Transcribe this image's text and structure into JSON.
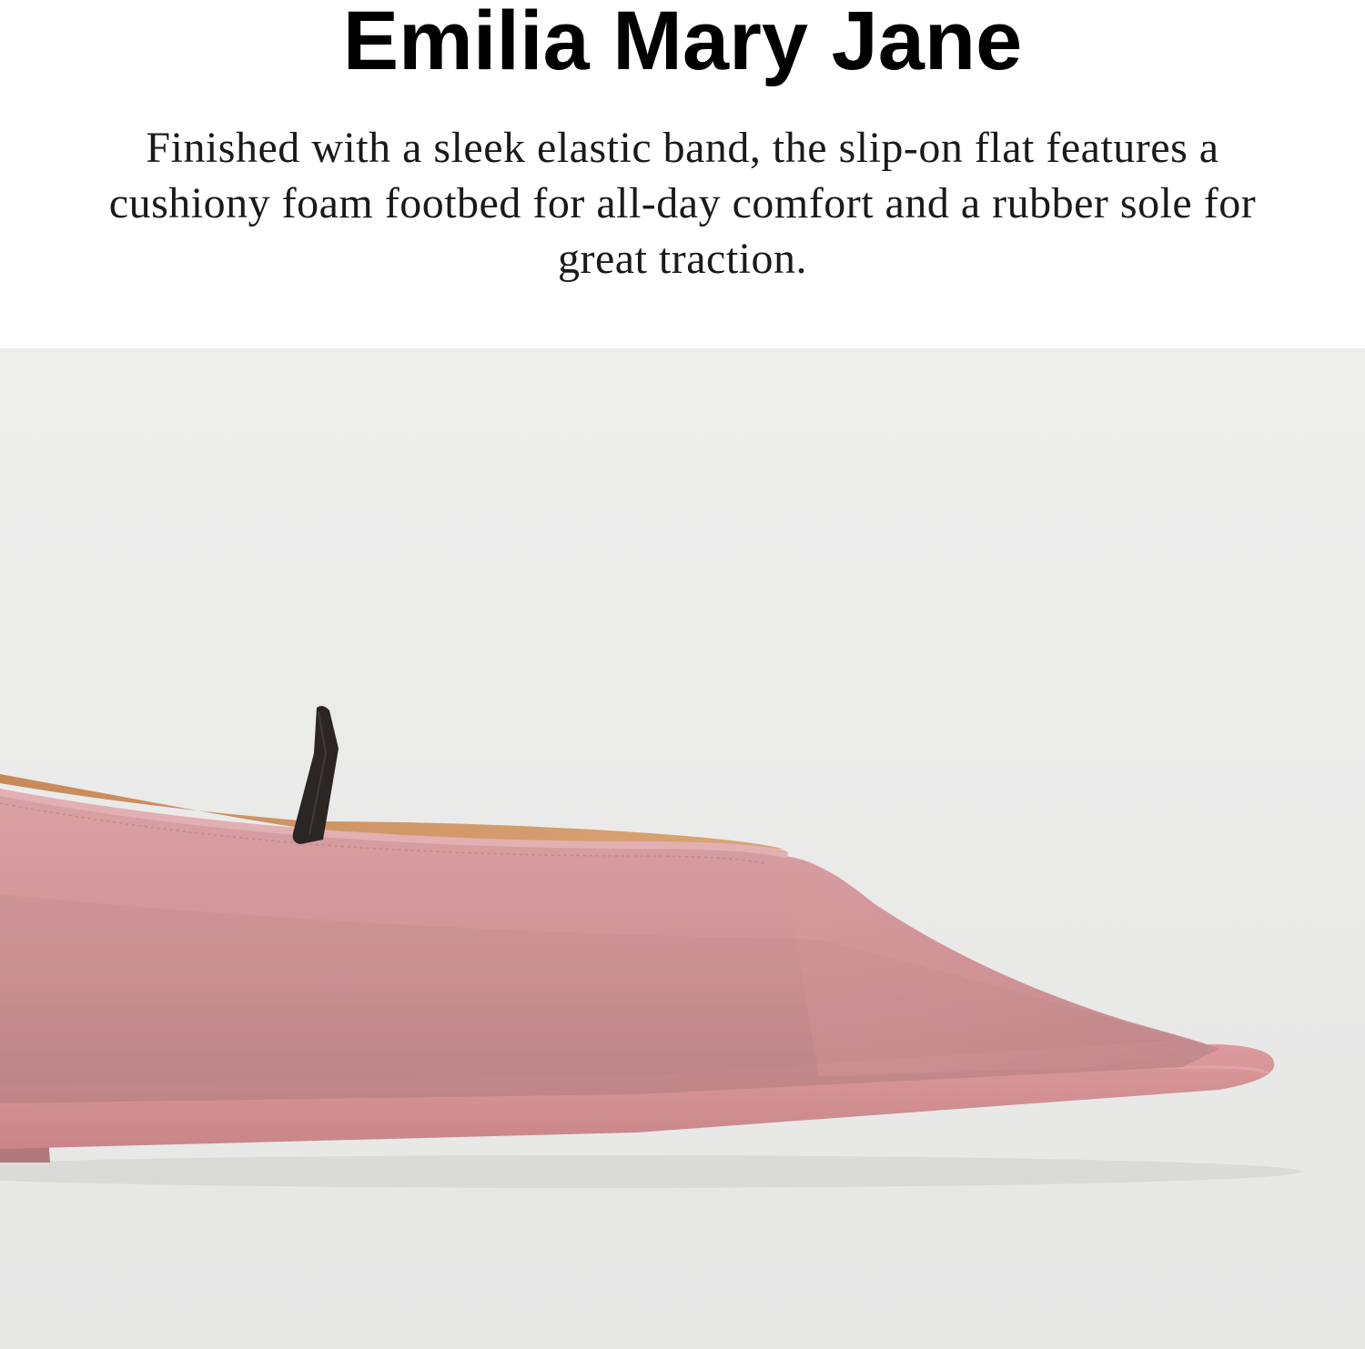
{
  "header": {
    "title": "Emilia Mary Jane",
    "description": "Finished with a sleek elastic band, the slip-on flat features a cushiony foam footbed for all-day comfort and a rubber sole for great traction."
  },
  "product_image": {
    "subject": "pink pointed-toe flat with black elastic band",
    "colors": {
      "background": "#e9e9e8",
      "shoe_upper": "#d4979a",
      "shoe_shadow": "#b97f82",
      "lining": "#d19a66",
      "elastic_band": "#2a2624",
      "sole": "#d08c8f"
    }
  }
}
